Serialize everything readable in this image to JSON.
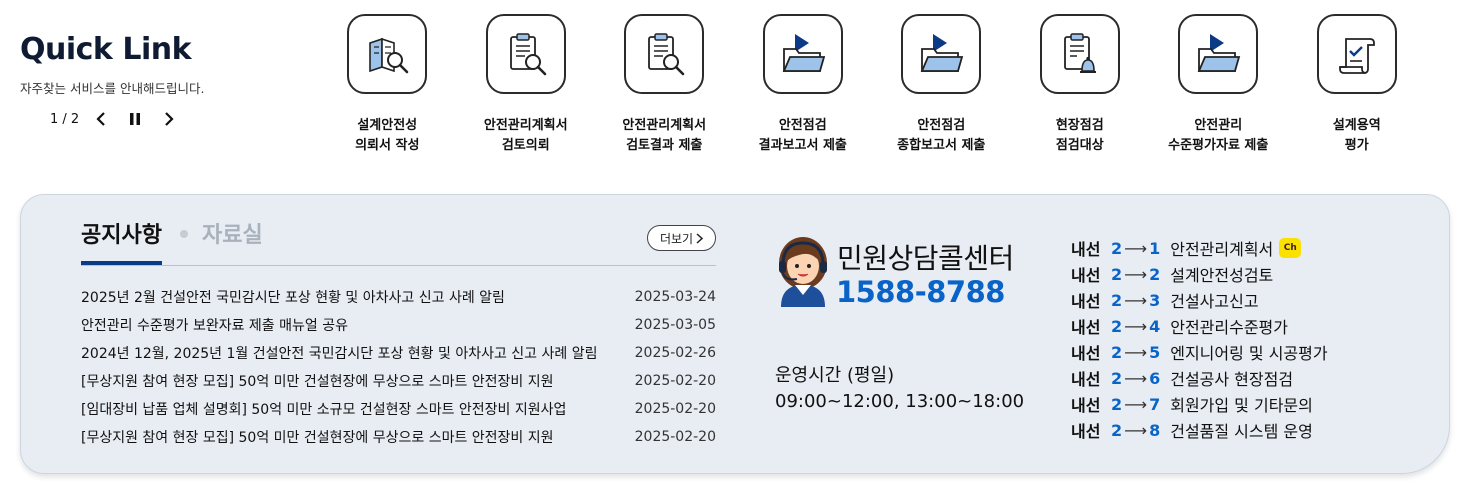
{
  "quick_link": {
    "title": "Quick Link",
    "subtitle": "자주찾는 서비스를 안내해드립니다.",
    "pager": {
      "count": "1 / 2"
    },
    "items": [
      {
        "icon": "blueprint-search-icon",
        "line1": "설계안전성",
        "line2": "의뢰서 작성"
      },
      {
        "icon": "document-search-icon",
        "line1": "안전관리계획서",
        "line2": "검토의뢰"
      },
      {
        "icon": "document-search-icon",
        "line1": "안전관리계획서",
        "line2": "검토결과 제출"
      },
      {
        "icon": "folder-play-icon",
        "line1": "안전점검",
        "line2": "결과보고서 제출"
      },
      {
        "icon": "folder-play-icon",
        "line1": "안전점검",
        "line2": "종합보고서 제출"
      },
      {
        "icon": "document-bell-icon",
        "line1": "현장점검",
        "line2": "점검대상"
      },
      {
        "icon": "folder-play-icon",
        "line1": "안전관리",
        "line2": "수준평가자료 제출"
      },
      {
        "icon": "scroll-check-icon",
        "line1": "설계용역",
        "line2": "평가"
      }
    ]
  },
  "notices": {
    "tab_active": "공지사항",
    "tab_inactive": "자료실",
    "more_label": "더보기",
    "rows": [
      {
        "title": "2025년 2월 건설안전 국민감시단 포상 현황 및 아차사고 신고 사례 알림",
        "date": "2025-03-24"
      },
      {
        "title": "안전관리 수준평가 보완자료 제출 매뉴얼 공유",
        "date": "2025-03-05"
      },
      {
        "title": "2024년 12월, 2025년 1월 건설안전 국민감시단 포상 현황 및 아차사고 신고 사례 알림",
        "date": "2025-02-26"
      },
      {
        "title": "[무상지원 참여 현장 모집] 50억 미만 건설현장에 무상으로 스마트 안전장비 지원",
        "date": "2025-02-20"
      },
      {
        "title": "[임대장비 납품 업체 설명회] 50억 미만 소규모 건설현장 스마트 안전장비 지원사업",
        "date": "2025-02-20"
      },
      {
        "title": "[무상지원 참여 현장 모집] 50억 미만 건설현장에 무상으로 스마트 안전장비 지원",
        "date": "2025-02-20"
      }
    ]
  },
  "call_center": {
    "name": "민원상담콜센터",
    "phone": "1588-8788",
    "hours_label": "운영시간 (평일)",
    "hours": "09:00~12:00, 13:00~18:00",
    "extensions": [
      {
        "prefix": "내선",
        "from": "2",
        "to": "1",
        "label": "안전관리계획서",
        "kakao": true,
        "kakao_text": "Ch"
      },
      {
        "prefix": "내선",
        "from": "2",
        "to": "2",
        "label": "설계안전성검토"
      },
      {
        "prefix": "내선",
        "from": "2",
        "to": "3",
        "label": "건설사고신고"
      },
      {
        "prefix": "내선",
        "from": "2",
        "to": "4",
        "label": "안전관리수준평가"
      },
      {
        "prefix": "내선",
        "from": "2",
        "to": "5",
        "label": "엔지니어링 및 시공평가"
      },
      {
        "prefix": "내선",
        "from": "2",
        "to": "6",
        "label": "건설공사 현장점검"
      },
      {
        "prefix": "내선",
        "from": "2",
        "to": "7",
        "label": "회원가입 및 기타문의"
      },
      {
        "prefix": "내선",
        "from": "2",
        "to": "8",
        "label": "건설품질 시스템 운영"
      }
    ]
  },
  "colors": {
    "accent": "#0a64c8",
    "tab_underline": "#0b3a86",
    "panel_bg": "#e8edf3",
    "kakao": "#fae100"
  }
}
